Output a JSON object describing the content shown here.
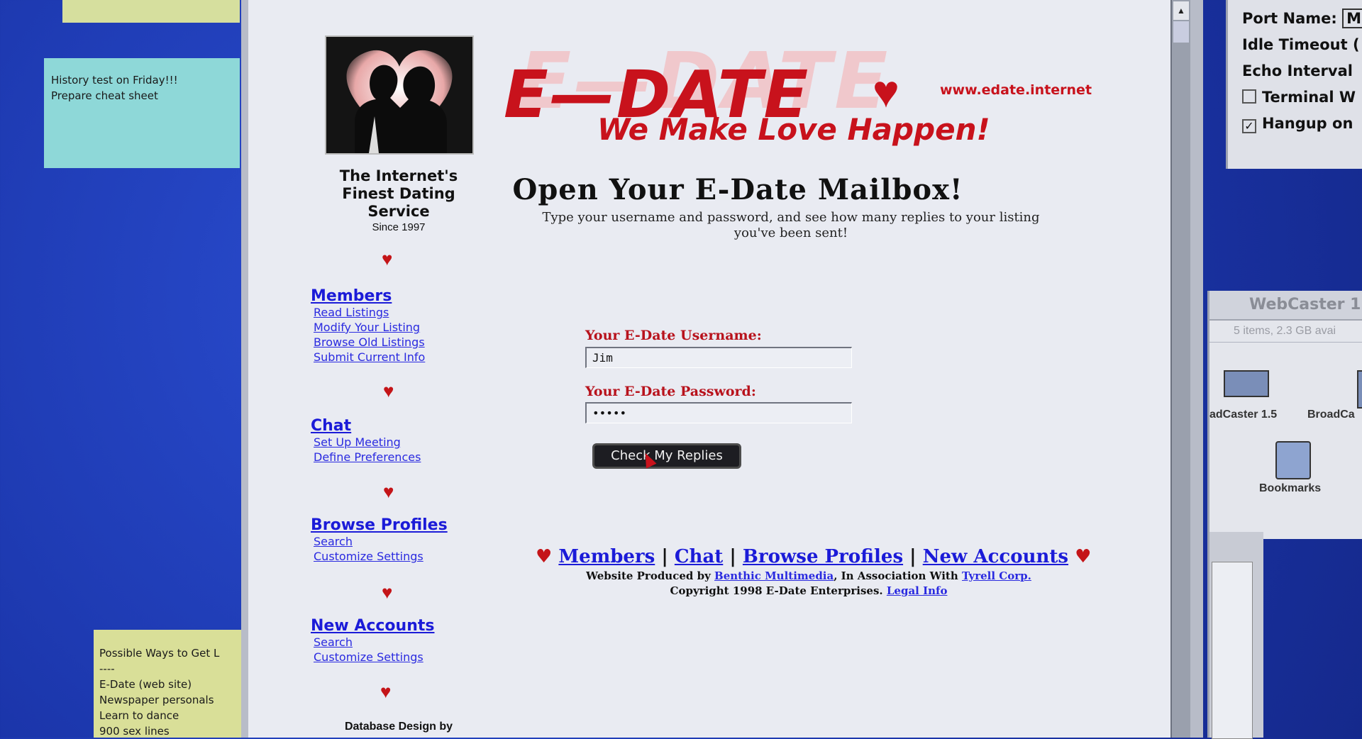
{
  "desktop": {
    "note_history": [
      "History test on Friday!!!",
      "Prepare cheat sheet"
    ],
    "note_ways": [
      "Possible Ways to Get L",
      "----",
      "E-Date (web site)",
      "Newspaper personals",
      "Learn to dance",
      "900 sex lines"
    ]
  },
  "sidebar": {
    "tagline": "The Internet's Finest Dating Service",
    "since": "Since 1997",
    "groups": [
      {
        "title": "Members",
        "links": [
          "Read Listings",
          "Modify Your Listing",
          "Browse Old Listings",
          "Submit Current Info"
        ]
      },
      {
        "title": "Chat",
        "links": [
          "Set Up Meeting",
          "Define Preferences"
        ]
      },
      {
        "title": "Browse Profiles",
        "links": [
          "Search",
          "Customize Settings"
        ]
      },
      {
        "title": "New Accounts",
        "links": [
          "Search",
          "Customize Settings"
        ]
      }
    ],
    "footer": "Database Design by"
  },
  "banner": {
    "brand": "E—DATE",
    "url": "www.edate.internet",
    "slogan": "We Make Love Happen!"
  },
  "main": {
    "heading": "Open Your E-Date Mailbox!",
    "subheading": "Type your username and password, and see how many replies to your listing you've been sent!",
    "username_label": "Your E-Date Username:",
    "username_value": "Jim",
    "password_label": "Your E-Date Password:",
    "password_value": "•••••",
    "submit_label": "Check My Replies"
  },
  "footer": {
    "nav": [
      "Members",
      "Chat",
      "Browse Profiles",
      "New Accounts"
    ],
    "separator": "|",
    "produced_prefix": "Website Produced by",
    "produced_by": "Benthic Multimedia",
    "association": ", In Association With",
    "partner": "Tyrell Corp.",
    "copyright": "Copyright 1998 E-Date Enterprises.",
    "legal": "Legal Info"
  },
  "right_panel": {
    "port_name": "Port Name:",
    "port_value": "M",
    "idle_timeout": "Idle Timeout (",
    "echo_interval": "Echo Interval",
    "terminal": "Terminal W",
    "hangup": "Hangup on"
  },
  "webcaster": {
    "title": "WebCaster 1.",
    "info": "5 items, 2.3 GB avai",
    "item1": "adCaster 1.5",
    "item2": "BroadCa",
    "item3": "Bookmarks"
  },
  "colors": {
    "brand": "#c8121c",
    "link": "#1b1bd8",
    "desktop": "#1f3fb8"
  }
}
